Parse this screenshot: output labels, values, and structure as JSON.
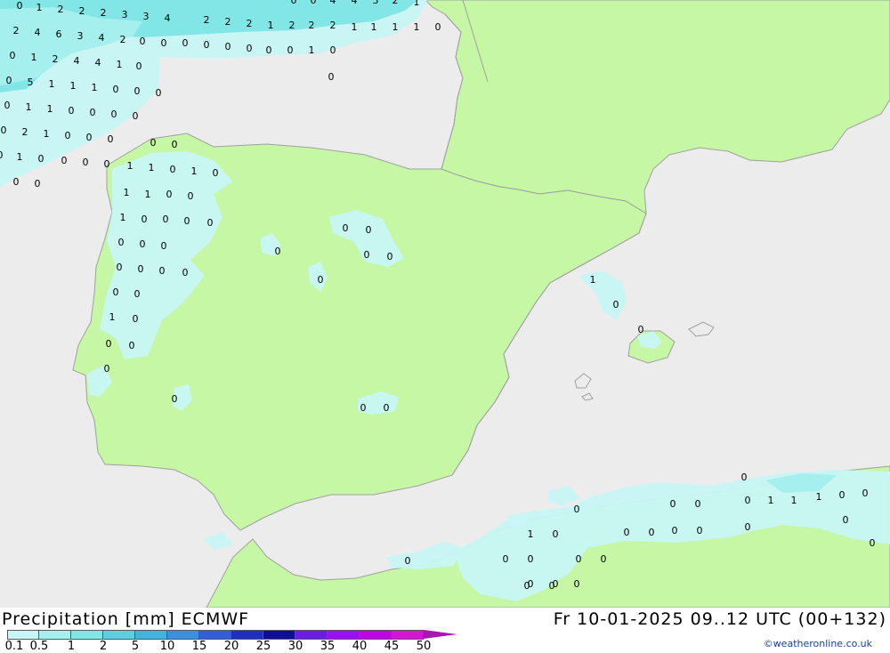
{
  "header": {
    "title": "Precipitation [mm] ECMWF",
    "datetime": "Fr 10-01-2025 09..12 UTC (00+132)",
    "credit": "©weatheronline.co.uk"
  },
  "colors": {
    "sea": "#ececec",
    "land": "#c6f7a4",
    "coast": "#a0a0a0"
  },
  "legend": {
    "labels": [
      "0.1",
      "0.5",
      "1",
      "2",
      "5",
      "10",
      "15",
      "20",
      "25",
      "30",
      "35",
      "40",
      "45",
      "50"
    ],
    "colors": [
      "#c8f5f5",
      "#a6efef",
      "#83e6e6",
      "#5fcde2",
      "#44b2df",
      "#3c8fdd",
      "#2f61d6",
      "#1e2fbe",
      "#0f0f96",
      "#6b1ee0",
      "#9a10ee",
      "#bb08e0",
      "#d316cf",
      "#a815b0"
    ]
  },
  "precip_areas": [
    {
      "name": "biscay-wet-area",
      "level": 1
    },
    {
      "name": "biscay-core-area",
      "level": 3
    },
    {
      "name": "galicia-coast-area",
      "level": 1
    },
    {
      "name": "portugal-coast-area",
      "level": 1
    },
    {
      "name": "central-spain-patch",
      "level": 1
    },
    {
      "name": "balearic-area",
      "level": 1
    },
    {
      "name": "alboran-area",
      "level": 1
    },
    {
      "name": "north-africa-area",
      "level": 1
    }
  ],
  "values": {
    "biscay": [
      "0",
      "1",
      "2",
      "2",
      "2",
      "3",
      "3",
      "4",
      "2",
      "2",
      "2",
      "1",
      "2",
      "2",
      "2",
      "1",
      "1",
      "1",
      "1",
      "0",
      "2",
      "4",
      "6",
      "3",
      "4",
      "2",
      "0",
      "0",
      "0",
      "0",
      "0",
      "0",
      "0",
      "0",
      "1",
      "0",
      "0",
      "1",
      "2",
      "4",
      "4",
      "1",
      "0",
      "0",
      "5",
      "1",
      "1",
      "1",
      "0",
      "0",
      "0",
      "0",
      "1",
      "1",
      "0",
      "0",
      "0",
      "0",
      "0",
      "2",
      "1",
      "0",
      "0",
      "0",
      "0",
      "1",
      "0",
      "0",
      "0",
      "0",
      "0",
      "0",
      "0",
      "0"
    ],
    "top_partial": [
      "0",
      "0",
      "4",
      "4",
      "3",
      "2",
      "1"
    ],
    "galicia_portugal": [
      "0",
      "0",
      "1",
      "1",
      "0",
      "1",
      "0",
      "1",
      "1",
      "0",
      "0",
      "1",
      "0",
      "0",
      "0",
      "0",
      "0",
      "0",
      "0",
      "0",
      "0",
      "0",
      "0",
      "0",
      "0",
      "1",
      "0",
      "0",
      "0",
      "0",
      "0",
      "0",
      "0"
    ],
    "interior": [
      "0",
      "0",
      "0",
      "0",
      "0",
      "0",
      "0",
      "0"
    ],
    "balearic": [
      "1",
      "0",
      "0"
    ],
    "south": [
      "0",
      "0",
      "1",
      "0",
      "0",
      "0",
      "0",
      "0",
      "0",
      "0",
      "0",
      "0",
      "0",
      "0",
      "1",
      "1",
      "1",
      "0",
      "0",
      "0",
      "0",
      "0",
      "0",
      "0",
      "0",
      "0",
      "0",
      "0",
      "0"
    ]
  }
}
